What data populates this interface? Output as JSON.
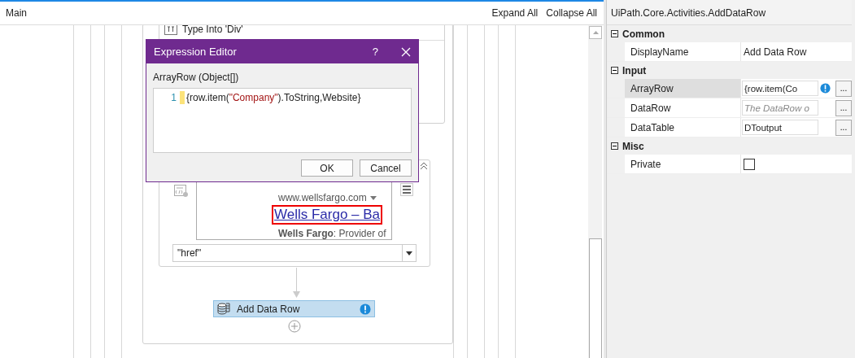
{
  "tab": {
    "title": "Main"
  },
  "toolbar": [
    "Expand All",
    "Collapse All"
  ],
  "designer": {
    "type_into_card": {
      "title": "Type Into 'Div'"
    },
    "element_card": {
      "preview": {
        "url": "www.wellsfargo.com",
        "link": "Wells Fargo – Ba",
        "snippet": "**Wells Fargo**: Provider of"
      },
      "attribute": "\"href\""
    },
    "add_data_row": {
      "label": "Add Data Row",
      "warning": true
    }
  },
  "dialog": {
    "title": "Expression Editor",
    "help": "?",
    "label": "ArrayRow (Object[])",
    "lines": [
      {
        "number": "1",
        "segments": [
          {
            "kind": "plain",
            "text": "{row.item("
          },
          {
            "kind": "string",
            "text": "\"Company\""
          },
          {
            "kind": "plain",
            "text": ").ToString,Website}"
          }
        ]
      }
    ],
    "buttons": [
      "OK",
      "Cancel"
    ]
  },
  "properties": {
    "title": "UiPath.Core.Activities.AddDataRow",
    "categories": [
      {
        "name": "Common",
        "expanded": true,
        "rows": [
          {
            "name": "DisplayName",
            "kind": "text",
            "value": "Add Data Row",
            "selected": false
          }
        ]
      },
      {
        "name": "Input",
        "expanded": true,
        "rows": [
          {
            "name": "ArrayRow",
            "kind": "expression",
            "value": "{row.item(Co",
            "warning": true,
            "button": "...",
            "selected": true
          },
          {
            "name": "DataRow",
            "kind": "expression",
            "placeholder": "The DataRow o",
            "warning": false,
            "button": "...",
            "selected": false
          },
          {
            "name": "DataTable",
            "kind": "expression",
            "value": "DToutput",
            "warning": false,
            "button": "...",
            "selected": false
          }
        ]
      },
      {
        "name": "Misc",
        "expanded": true,
        "rows": [
          {
            "name": "Private",
            "kind": "checkbox",
            "checked": false,
            "selected": false
          }
        ]
      }
    ]
  }
}
